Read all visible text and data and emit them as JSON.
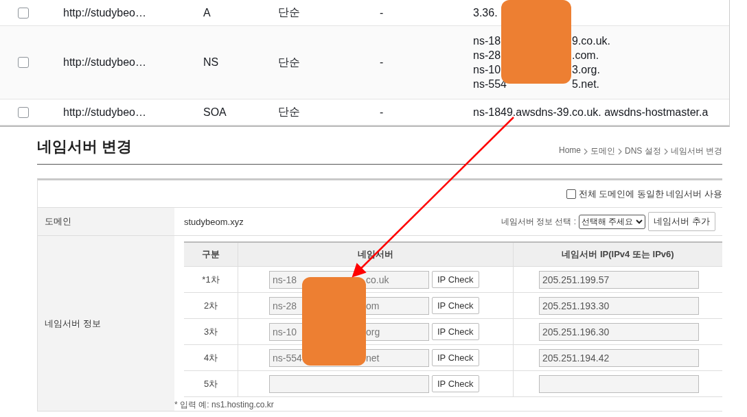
{
  "records": [
    {
      "checked": false,
      "url": "http://studybeo…",
      "type": "A",
      "routing": "단순",
      "column_5": "-",
      "value_lines": [
        {
          "start": "3.36."
        }
      ]
    },
    {
      "checked": false,
      "url": "http://studybeo…",
      "type": "NS",
      "routing": "단순",
      "column_5": "-",
      "value_lines": [
        {
          "start": "ns-18",
          "end": "9.co.uk."
        },
        {
          "start": "ns-28",
          "end": ".com."
        },
        {
          "start": "ns-10",
          "end": "3.org."
        },
        {
          "start": "ns-554",
          "end": "5.net."
        }
      ]
    },
    {
      "checked": false,
      "url": "http://studybeo…",
      "type": "SOA",
      "routing": "단순",
      "column_5": "-",
      "value_lines": [
        {
          "start": "ns-1849.awsdns-39.co.uk. awsdns-hostmaster.a"
        }
      ]
    }
  ],
  "page": {
    "title": "네임서버 변경",
    "breadcrumb": [
      "Home",
      "도메인",
      "DNS 설정",
      "네임서버 변경"
    ]
  },
  "form": {
    "same_for_all": {
      "label": "전체 도메인에 동일한 네임서버 사용",
      "checked": false
    },
    "domain_label": "도메인",
    "domain": "studybeom.xyz",
    "select_label": "네임서버 정보 선택 :",
    "select_value": "선택해 주세요",
    "add_button": "네임서버 추가",
    "ns_label": "네임서버 정보",
    "columns": [
      "구분",
      "네임서버",
      "네임서버 IP(IPv4 또는 IPv6)"
    ],
    "rows": [
      {
        "order": "*1차",
        "ns_start": "ns-18",
        "ns_end": "co.uk",
        "check": "IP Check",
        "ip": "205.251.199.57"
      },
      {
        "order": "2차",
        "ns_start": "ns-28",
        "ns_end": "om",
        "check": "IP Check",
        "ip": "205.251.193.30"
      },
      {
        "order": "3차",
        "ns_start": "ns-10",
        "ns_end": "org",
        "check": "IP Check",
        "ip": "205.251.196.30"
      },
      {
        "order": "4차",
        "ns_start": "ns-554",
        "ns_end": "net",
        "check": "IP Check",
        "ip": "205.251.194.42"
      },
      {
        "order": "5차",
        "check": "IP Check"
      }
    ],
    "note": "* 입력 예: ns1.hosting.co.kr"
  }
}
